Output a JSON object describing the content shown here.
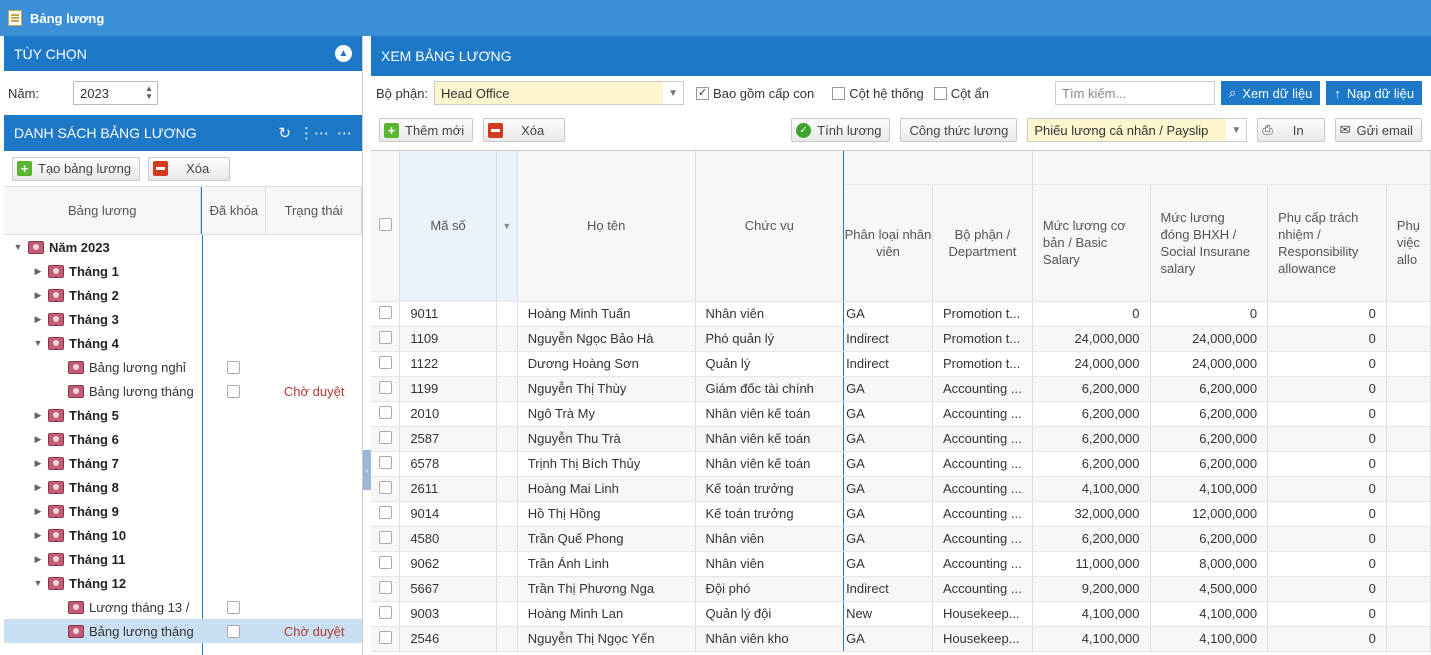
{
  "window": {
    "title": "Bảng lương"
  },
  "left": {
    "options_title": "TÙY CHỌN",
    "year_label": "Năm:",
    "year_value": "2023",
    "list_title": "DANH SÁCH BẢNG LƯƠNG",
    "create_btn": "Tạo bảng lương",
    "delete_btn": "Xóa",
    "headers": {
      "name": "Bảng lương",
      "locked": "Đã khóa",
      "status": "Trạng thái"
    },
    "tree": [
      {
        "label": "Năm 2023",
        "level": 0,
        "toggle": "▼",
        "bold": true,
        "cb": false,
        "status": ""
      },
      {
        "label": "Tháng 1",
        "level": 1,
        "toggle": "▶",
        "bold": true,
        "cb": false,
        "status": ""
      },
      {
        "label": "Tháng 2",
        "level": 1,
        "toggle": "▶",
        "bold": true,
        "cb": false,
        "status": ""
      },
      {
        "label": "Tháng 3",
        "level": 1,
        "toggle": "▶",
        "bold": true,
        "cb": false,
        "status": ""
      },
      {
        "label": "Tháng 4",
        "level": 1,
        "toggle": "▼",
        "bold": true,
        "cb": false,
        "status": ""
      },
      {
        "label": "Bảng lương nghỉ",
        "level": 2,
        "toggle": "",
        "bold": false,
        "cb": true,
        "status": ""
      },
      {
        "label": "Bảng lương tháng",
        "level": 2,
        "toggle": "",
        "bold": false,
        "cb": true,
        "status": "Chờ duyệt"
      },
      {
        "label": "Tháng 5",
        "level": 1,
        "toggle": "▶",
        "bold": true,
        "cb": false,
        "status": ""
      },
      {
        "label": "Tháng 6",
        "level": 1,
        "toggle": "▶",
        "bold": true,
        "cb": false,
        "status": ""
      },
      {
        "label": "Tháng 7",
        "level": 1,
        "toggle": "▶",
        "bold": true,
        "cb": false,
        "status": ""
      },
      {
        "label": "Tháng 8",
        "level": 1,
        "toggle": "▶",
        "bold": true,
        "cb": false,
        "status": ""
      },
      {
        "label": "Tháng 9",
        "level": 1,
        "toggle": "▶",
        "bold": true,
        "cb": false,
        "status": ""
      },
      {
        "label": "Tháng 10",
        "level": 1,
        "toggle": "▶",
        "bold": true,
        "cb": false,
        "status": ""
      },
      {
        "label": "Tháng 11",
        "level": 1,
        "toggle": "▶",
        "bold": true,
        "cb": false,
        "status": ""
      },
      {
        "label": "Tháng 12",
        "level": 1,
        "toggle": "▼",
        "bold": true,
        "cb": false,
        "status": ""
      },
      {
        "label": "Lương tháng 13 /",
        "level": 2,
        "toggle": "",
        "bold": false,
        "cb": true,
        "status": ""
      },
      {
        "label": "Bảng lương tháng",
        "level": 2,
        "toggle": "",
        "bold": false,
        "cb": true,
        "status": "Chờ duyệt",
        "selected": true
      }
    ]
  },
  "right": {
    "title": "XEM BẢNG LƯƠNG",
    "dept_label": "Bộ phận:",
    "dept_value": "Head Office",
    "include_sub": "Bao gồm cấp con",
    "sys_cols": "Cột hệ thống",
    "hidden_cols": "Cột ẩn",
    "search_placeholder": "Tìm kiếm...",
    "view_btn": "Xem dữ liệu",
    "load_btn": "Nạp dữ liệu",
    "add_btn": "Thêm mới",
    "delete_btn": "Xóa",
    "calc_btn": "Tính lương",
    "formula_btn": "Công thức lương",
    "payslip_value": "Phiếu lương cá nhân / Payslip",
    "print_btn": "In",
    "email_btn": "Gửi email",
    "columns": {
      "code": "Mã số",
      "name": "Họ tên",
      "position": "Chức vụ",
      "emp_type": "Phân loại nhân viên",
      "dept": "Bộ phận / Department",
      "basic": "Mức lương cơ bản / Basic Salary",
      "bhxh": "Mức lương đóng BHXH / Social Insurane salary",
      "resp": "Phụ cấp trách nhiệm / Responsibility allowance",
      "extra": "Phụ việc allo"
    },
    "rows": [
      {
        "code": "9011",
        "name": "Hoàng Minh Tuấn",
        "position": "Nhân viên",
        "type": "GA",
        "dept": "Promotion t...",
        "basic": "0",
        "bhxh": "0",
        "resp": "0"
      },
      {
        "code": "1109",
        "name": "Nguyễn Ngọc Bảo Hà",
        "position": "Phó quản lý",
        "type": "Indirect",
        "dept": "Promotion t...",
        "basic": "24,000,000",
        "bhxh": "24,000,000",
        "resp": "0"
      },
      {
        "code": "1122",
        "name": "Dương Hoàng Sơn",
        "position": "Quản lý",
        "type": "Indirect",
        "dept": "Promotion t...",
        "basic": "24,000,000",
        "bhxh": "24,000,000",
        "resp": "0"
      },
      {
        "code": "1199",
        "name": "Nguyễn Thị Thùy",
        "position": "Giám đốc tài chính",
        "type": "GA",
        "dept": "Accounting ...",
        "basic": "6,200,000",
        "bhxh": "6,200,000",
        "resp": "0"
      },
      {
        "code": "2010",
        "name": "Ngô Trà My",
        "position": "Nhân viên kế toán",
        "type": "GA",
        "dept": "Accounting ...",
        "basic": "6,200,000",
        "bhxh": "6,200,000",
        "resp": "0"
      },
      {
        "code": "2587",
        "name": "Nguyễn Thu Trà",
        "position": "Nhân viên kế toán",
        "type": "GA",
        "dept": "Accounting ...",
        "basic": "6,200,000",
        "bhxh": "6,200,000",
        "resp": "0"
      },
      {
        "code": "6578",
        "name": "Trịnh Thị Bích Thủy",
        "position": "Nhân viên kế toán",
        "type": "GA",
        "dept": "Accounting ...",
        "basic": "6,200,000",
        "bhxh": "6,200,000",
        "resp": "0"
      },
      {
        "code": "2611",
        "name": "Hoàng Mai Linh",
        "position": "Kế toán trưởng",
        "type": "GA",
        "dept": "Accounting ...",
        "basic": "4,100,000",
        "bhxh": "4,100,000",
        "resp": "0"
      },
      {
        "code": "9014",
        "name": "Hồ Thị Hồng",
        "position": "Kế toán trưởng",
        "type": "GA",
        "dept": "Accounting ...",
        "basic": "32,000,000",
        "bhxh": "12,000,000",
        "resp": "0"
      },
      {
        "code": "4580",
        "name": "Trần Quế Phong",
        "position": "Nhân viên",
        "type": "GA",
        "dept": "Accounting ...",
        "basic": "6,200,000",
        "bhxh": "6,200,000",
        "resp": "0"
      },
      {
        "code": "9062",
        "name": "Trần Ánh Linh",
        "position": "Nhân viên",
        "type": "GA",
        "dept": "Accounting ...",
        "basic": "11,000,000",
        "bhxh": "8,000,000",
        "resp": "0"
      },
      {
        "code": "5667",
        "name": "Trần Thị Phương Nga",
        "position": "Đội phó",
        "type": "Indirect",
        "dept": "Accounting ...",
        "basic": "9,200,000",
        "bhxh": "4,500,000",
        "resp": "0"
      },
      {
        "code": "9003",
        "name": "Hoàng Minh Lan",
        "position": "Quản lý đội",
        "type": "New",
        "dept": "Housekeep...",
        "basic": "4,100,000",
        "bhxh": "4,100,000",
        "resp": "0"
      },
      {
        "code": "2546",
        "name": "Nguyễn Thị Ngọc Yến",
        "position": "Nhân viên kho",
        "type": "GA",
        "dept": "Housekeep...",
        "basic": "4,100,000",
        "bhxh": "4,100,000",
        "resp": "0"
      }
    ]
  },
  "colors": {
    "header_blue": "#1d78c8",
    "title_blue": "#3a8fd6",
    "combo_yellow": "#fdf6cf",
    "status_red": "#b23a2e",
    "selected_row": "#c9dff4"
  }
}
